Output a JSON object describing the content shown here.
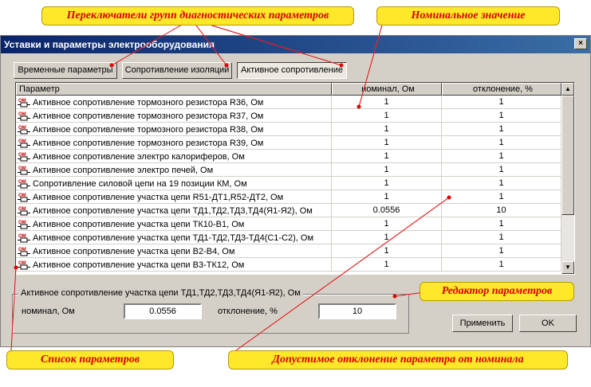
{
  "window": {
    "title": "Уставки и параметры электрооборудования",
    "close_glyph": "×"
  },
  "tabs": [
    {
      "label": "Временные параметры"
    },
    {
      "label": "Сопротивление изоляций"
    },
    {
      "label": "Активное сопротивление"
    }
  ],
  "grid": {
    "headers": [
      "Параметр",
      "номинал, Ом",
      "отклонение, %"
    ],
    "rows": [
      {
        "name": "Активное сопротивление тормозного резистора R36, Ом",
        "nominal": "1",
        "deviation": "1"
      },
      {
        "name": "Активное сопротивление тормозного резистора R37, Ом",
        "nominal": "1",
        "deviation": "1"
      },
      {
        "name": "Активное сопротивление тормозного резистора R38, Ом",
        "nominal": "1",
        "deviation": "1"
      },
      {
        "name": "Активное сопротивление тормозного резистора R39, Ом",
        "nominal": "1",
        "deviation": "1"
      },
      {
        "name": "Активное сопротивление электро калориферов, Ом",
        "nominal": "1",
        "deviation": "1"
      },
      {
        "name": "Активное сопротивление электро печей, Ом",
        "nominal": "1",
        "deviation": "1"
      },
      {
        "name": "Сопротивление силовой цепи на 19 позиции КМ, Ом",
        "nominal": "1",
        "deviation": "1"
      },
      {
        "name": "Активное сопротивление участка цепи R51-ДТ1,R52-ДТ2, Ом",
        "nominal": "1",
        "deviation": "1"
      },
      {
        "name": "Активное сопротивление участка цепи ТД1,ТД2,ТД3,ТД4(Я1-Я2), Ом",
        "nominal": "0.0556",
        "deviation": "10"
      },
      {
        "name": "Активное сопротивление участка цепи ТК10-В1, Ом",
        "nominal": "1",
        "deviation": "1"
      },
      {
        "name": "Активное сопротивление участка цепи  ТД1-ТД2,ТД3-ТД4(С1-С2), Ом",
        "nominal": "1",
        "deviation": "1"
      },
      {
        "name": "Активное сопротивление участка цепи  В2-В4, Ом",
        "nominal": "1",
        "deviation": "1"
      },
      {
        "name": "Активное сопротивление участка цепи  В3-ТК12, Ом",
        "nominal": "1",
        "deviation": "1"
      }
    ],
    "row_icon": "ohm-resistor-icon",
    "row_icon_text": "ОМ",
    "scroll_up": "▲",
    "scroll_down": "▼"
  },
  "editor": {
    "group_label": "Активное сопротивление участка цепи ТД1,ТД2,ТД3,ТД4(Я1-Я2), Ом",
    "nominal_label": "номинал, Ом",
    "nominal_value": "0.0556",
    "deviation_label": "отклонение, %",
    "deviation_value": "10"
  },
  "buttons": {
    "apply": "Применить",
    "ok": "OK"
  },
  "callouts": {
    "group_switches": "Переключатели групп диагностических параметров",
    "nominal_value": "Номинальное значение",
    "param_editor": "Редактор параметров",
    "param_list": "Список параметров",
    "tolerance": "Допустимое отклонение параметра от номинала"
  },
  "colors": {
    "callout_fill": "#ffe82a",
    "callout_text": "#d40000",
    "title_start": "#0a246a",
    "title_end": "#3a6ea5"
  }
}
